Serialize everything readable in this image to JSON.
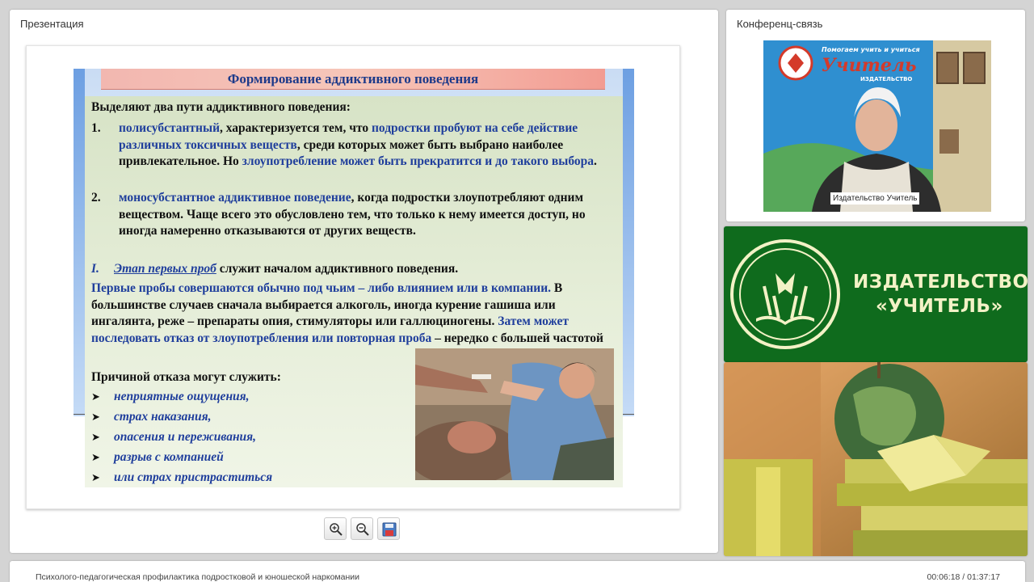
{
  "presentation_panel": {
    "title": "Презентация"
  },
  "conference_panel": {
    "title": "Конференц-связь",
    "video_label": "Издательство Учитель"
  },
  "slide": {
    "title": "Формирование аддиктивного поведения",
    "intro": "Выделяют два пути аддиктивного поведения:",
    "item1_num": "1.",
    "item1_a": "полисубстантный",
    "item1_b": ", характеризуется тем, что ",
    "item1_c": "подростки пробуют на себе действие различных токсичных веществ",
    "item1_d": ", среди которых может быть выбрано наиболее привлекательное. Но ",
    "item1_e": "злоупотребление может быть прекратится и до такого выбора",
    "item1_f": ".",
    "item2_num": "2.",
    "item2_a": "моносубстантное аддиктивное поведение",
    "item2_b": ", когда подростки злоупотребляют одним веществом. Чаще всего это обусловлено тем, что только к нему имеется доступ, но иногда намеренно отказываются от других веществ.",
    "stage_num": "I.",
    "stage_a": "Этап первых проб",
    "stage_b": " служит началом аддиктивного поведения.",
    "para_a": "Первые пробы совершаются обычно под чьим – либо влиянием или в компании.",
    "para_b": " В большинстве случаев сначала выбирается алкоголь, иногда курение гашиша или ингалянта, реже – препараты опия, стимуляторы или галлюциногены. ",
    "para_c": "Затем может последовать отказ от злоупотребления или повторная проба",
    "para_d": " – нередко с большей частотой",
    "reasons_title": "Причиной отказа могут служить:",
    "bullets": [
      "неприятные ощущения,",
      "страх наказания,",
      "опасения и переживания,",
      "разрыв с компанией",
      "или страх пристраститься"
    ],
    "bullet_mark": "➤"
  },
  "brand": {
    "line1": "ИЗДАТЕЛЬСТВО",
    "line2": "«УЧИТЕЛЬ»"
  },
  "video_bg": {
    "banner_top": "Помогаем учить и учиться",
    "banner_brand": "Учитель",
    "banner_sub": "ИЗДАТЕЛЬСТВО"
  },
  "footer": {
    "course_title": "Психолого-педагогическая профилактика подростковой и юношеской наркомании",
    "time": "00:06:18 / 01:37:17"
  }
}
